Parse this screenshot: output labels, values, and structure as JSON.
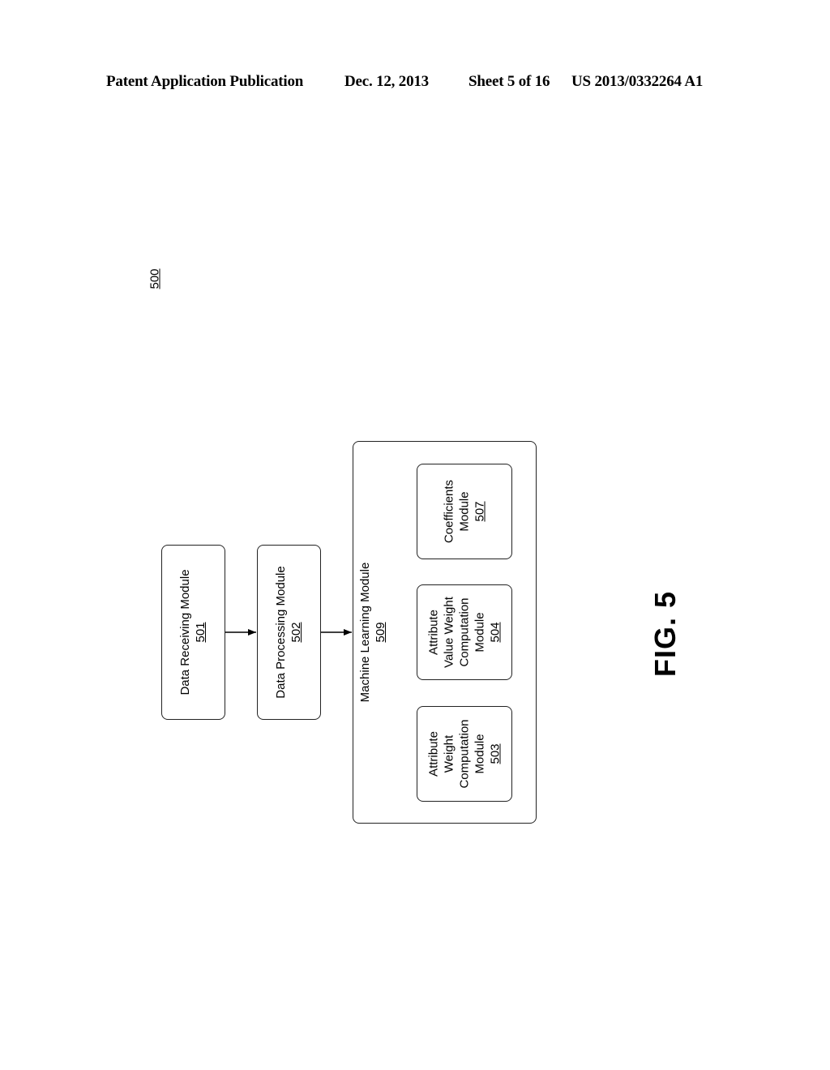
{
  "header": {
    "publication": "Patent Application Publication",
    "date": "Dec. 12, 2013",
    "sheet": "Sheet 5 of 16",
    "number": "US 2013/0332264 A1"
  },
  "diagram": {
    "reference": "500",
    "figure_label": "FIG. 5",
    "modules": {
      "data_receiving": {
        "lines": [
          "Data Receiving Module"
        ],
        "ref": "501"
      },
      "data_processing": {
        "lines": [
          "Data Processing Module"
        ],
        "ref": "502"
      },
      "machine_learning": {
        "lines": [
          "Machine Learning Module"
        ],
        "ref": "509"
      },
      "attribute_weight": {
        "lines": [
          "Attribute",
          "Weight",
          "Computation",
          "Module"
        ],
        "ref": "503"
      },
      "attribute_value_weight": {
        "lines": [
          "Attribute",
          "Value Weight",
          "Computation",
          "Module"
        ],
        "ref": "504"
      },
      "coefficients": {
        "lines": [
          "Coefficients",
          "Module"
        ],
        "ref": "507"
      }
    },
    "connections": [
      {
        "from": "data_receiving",
        "to": "data_processing"
      },
      {
        "from": "data_processing",
        "to": "machine_learning"
      }
    ]
  }
}
